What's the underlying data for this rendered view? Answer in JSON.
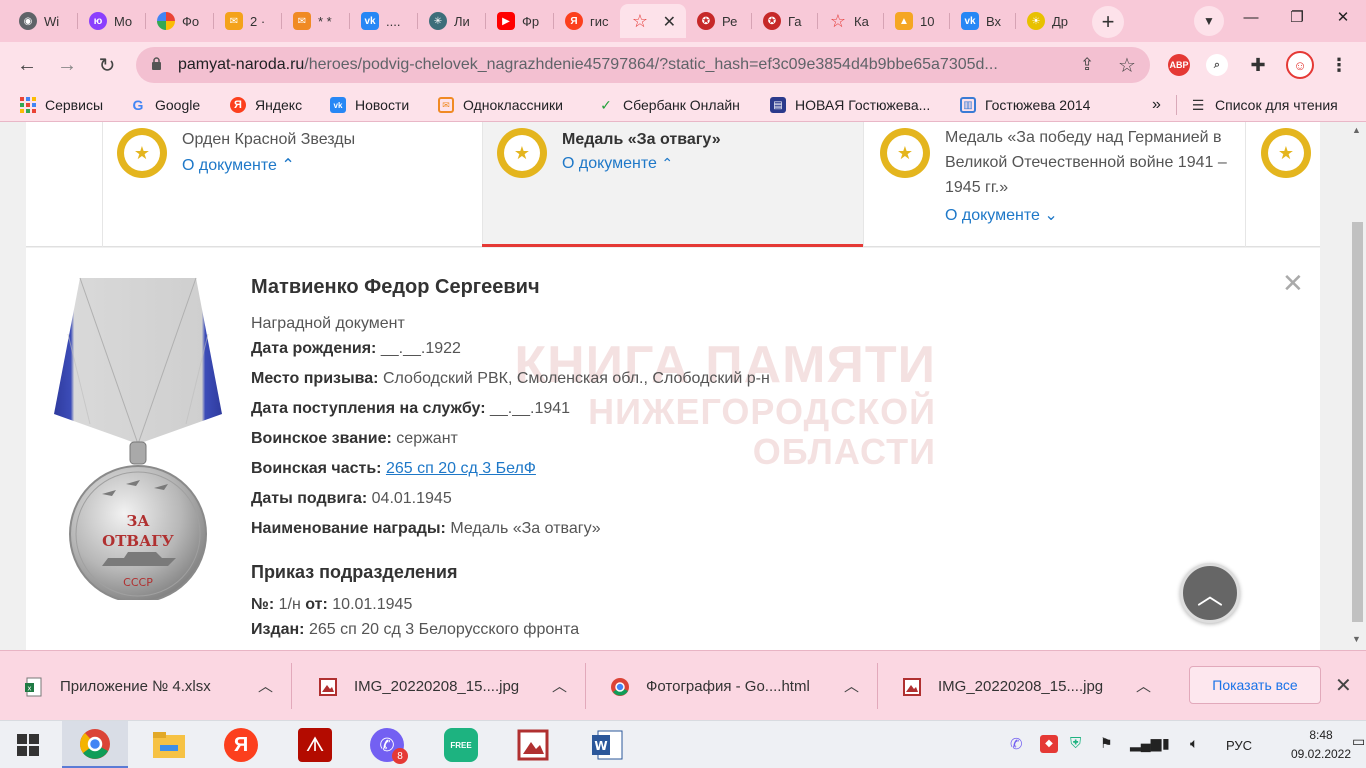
{
  "tabs": [
    {
      "label": "Wi",
      "icon": "chrome-icon",
      "color": "#5f6368"
    },
    {
      "label": "Mo",
      "icon": "yoomoney-icon",
      "color": "#8b3ffd"
    },
    {
      "label": "Фо",
      "icon": "google-photos-icon",
      "color": "#ea4335"
    },
    {
      "label": "2 ·",
      "icon": "mail-icon",
      "color": "#f4a21b"
    },
    {
      "label": "* *",
      "icon": "ok-mail-icon",
      "color": "#f08a24"
    },
    {
      "label": "....",
      "icon": "vk-icon",
      "color": "#2787f5"
    },
    {
      "label": "Ли",
      "icon": "wheel-icon",
      "color": "#3d6e7a"
    },
    {
      "label": "Фр",
      "icon": "youtube-icon",
      "color": "#ff0000"
    },
    {
      "label": "гис",
      "icon": "yandex-icon",
      "color": "#fc3f1d"
    },
    {
      "label": "",
      "icon": "star-outline-icon",
      "color": "#e53935"
    },
    {
      "label": "Ре",
      "icon": "medal-icon",
      "color": "#c62828"
    },
    {
      "label": "Га",
      "icon": "medal-icon",
      "color": "#c62828"
    },
    {
      "label": "Ка",
      "icon": "star-outline-icon",
      "color": "#e53935"
    },
    {
      "label": "10",
      "icon": "mountain-icon",
      "color": "#f5a623"
    },
    {
      "label": "Вх",
      "icon": "vk-icon",
      "color": "#2787f5"
    },
    {
      "label": "Др",
      "icon": "sun-icon",
      "color": "#e8c100"
    }
  ],
  "address": {
    "host": "pamyat-naroda.ru",
    "path": "/heroes/podvig-chelovek_nagrazhdenie45797864/?static_hash=ef3c09e3854d4b9bbe65a7305d..."
  },
  "extensions": {
    "abp": "ABP"
  },
  "bookmarks": [
    {
      "label": "Сервисы",
      "icon": "apps-grid-icon"
    },
    {
      "label": "Google",
      "icon": "google-icon"
    },
    {
      "label": "Яндекс",
      "icon": "yandex-icon"
    },
    {
      "label": "Новости",
      "icon": "vk-icon"
    },
    {
      "label": "Одноклассники",
      "icon": "ok-mail-icon"
    },
    {
      "label": "Сбербанк Онлайн",
      "icon": "sber-icon"
    },
    {
      "label": "НОВАЯ Гостюжева...",
      "icon": "doc-blue-icon"
    },
    {
      "label": "Гостюжева 2014",
      "icon": "doc-blue-icon"
    }
  ],
  "bookmarks_more": "»",
  "reading_list": "Список для чтения",
  "awards": [
    {
      "title": "Орден Красной Звезды",
      "link": "О документе",
      "caret": "⌃"
    },
    {
      "title": "Медаль «За отвагу»",
      "link": "О документе",
      "caret": "⌃"
    },
    {
      "title_lines": [
        "Медаль «За победу над Германией в",
        "Великой Отечественной войне 1941 –",
        "1945 гг.»"
      ],
      "link": "О документе",
      "caret": "⌄"
    }
  ],
  "detail": {
    "name": "Матвиенко Федор Сергеевич",
    "doc_type": "Наградной документ",
    "fields": [
      {
        "label": "Дата рождения:",
        "value": "__.__.1922"
      },
      {
        "label": "Место призыва:",
        "value": "Слободский РВК, Смоленская обл., Слободский р-н"
      },
      {
        "label": "Дата поступления на службу:",
        "value": "__.__.1941"
      },
      {
        "label": "Воинское звание:",
        "value": "сержант"
      },
      {
        "label": "Воинская часть:",
        "value": "265 сп 20 сд 3 БелФ"
      },
      {
        "label": "Даты подвига:",
        "value": "04.01.1945"
      },
      {
        "label": "Наименование награды:",
        "value": "Медаль «За отвагу»"
      }
    ],
    "order_section": "Приказ подразделения",
    "order_num_label": "№:",
    "order_num": "1/н",
    "order_from_label": "от:",
    "order_date": "10.01.1945",
    "issued_label": "Издан:",
    "issued_value": "265 сп 20 сд 3 Белорусского фронта"
  },
  "watermark": {
    "line1": "КНИГА ПАМЯТИ",
    "line2": "НИЖЕГОРОДСКОЙ ОБЛАСТИ"
  },
  "medal_image": {
    "text1": "ЗА",
    "text2": "ОТВАГУ",
    "text3": "СССР"
  },
  "downloads": [
    {
      "name": "Приложение № 4.xlsx",
      "icon": "excel-file-icon"
    },
    {
      "name": "IMG_20220208_15....jpg",
      "icon": "image-file-icon"
    },
    {
      "name": "Фотография - Go....html",
      "icon": "chrome-icon"
    },
    {
      "name": "IMG_20220208_15....jpg",
      "icon": "image-file-icon"
    }
  ],
  "show_all": "Показать все",
  "taskbar": {
    "viber_badge": "8",
    "lang": "РУС",
    "time": "8:48",
    "date": "09.02.2022",
    "free_label": "FREE"
  },
  "colors": {
    "accent_red": "#e53935",
    "link_blue": "#1e78c8",
    "medal_gold": "#e4b51e",
    "chrome_pink": "#fde2ea"
  }
}
